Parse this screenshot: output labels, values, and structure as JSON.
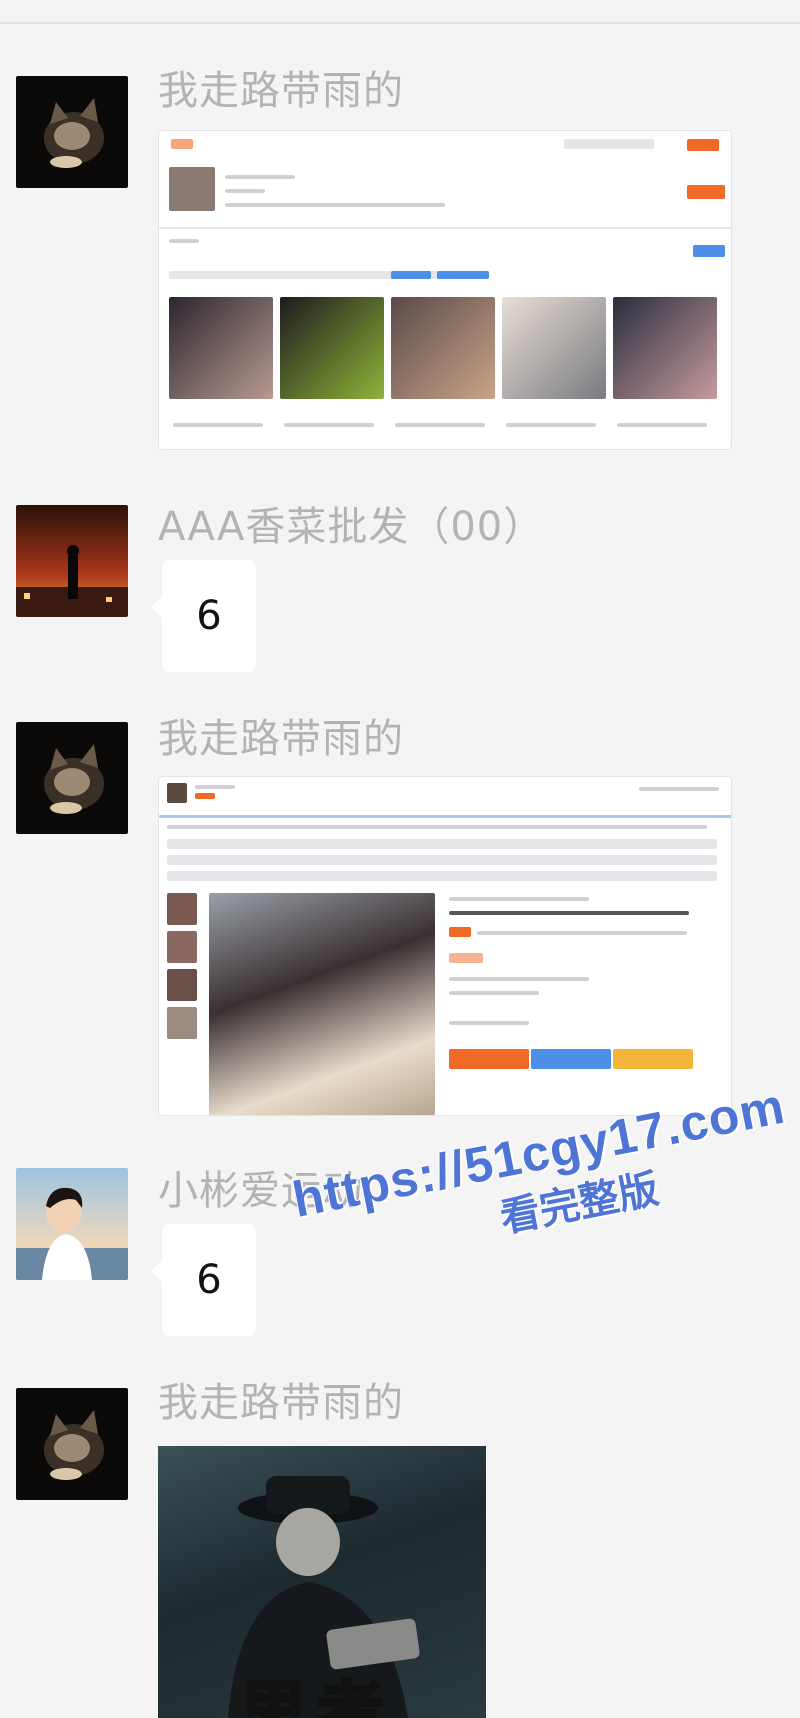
{
  "messages": [
    {
      "sender": "我走路带雨的",
      "type": "screenshot",
      "avatar": "cat-avatar"
    },
    {
      "sender": "AAA香菜批发（00）",
      "type": "text",
      "text": "6",
      "avatar": "night-city-avatar"
    },
    {
      "sender": "我走路带雨的",
      "type": "screenshot",
      "avatar": "cat-avatar"
    },
    {
      "sender": "小彬爱运动",
      "type": "text",
      "text": "6",
      "avatar": "boy-avatar"
    },
    {
      "sender": "我走路带雨的",
      "type": "gif",
      "avatar": "cat-avatar",
      "gif_caption": "思考"
    }
  ],
  "watermark": {
    "url": "https://51cgy17.com",
    "subtitle": "看完整版"
  },
  "colors": {
    "background": "#f4f4f5",
    "sender_name": "#b3b3b6",
    "bubble": "#ffffff",
    "watermark": "#4e74d6",
    "accent_orange": "#f06a27"
  }
}
